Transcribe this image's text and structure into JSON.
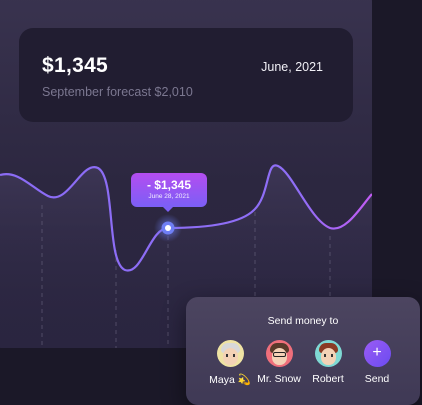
{
  "balance": {
    "amount": "$1,345",
    "date": "June, 2021",
    "forecast": "September forecast $2,010"
  },
  "chart_data": {
    "type": "line",
    "tooltip_amount": "- $1,345",
    "tooltip_date": "June 28, 2021",
    "colors": {
      "line": "#8b6cf5",
      "line_end": "#c25cf5",
      "point": "#6f7ff5"
    }
  },
  "send_money": {
    "title": "Send money to",
    "contacts": [
      {
        "name": "Maya",
        "emoji": "💫",
        "bg": "#efe3a4",
        "hair": "#d8d8d8"
      },
      {
        "name": "Mr. Snow",
        "emoji": "",
        "bg": "#ef6f7b",
        "hair": "#5a3a2a"
      },
      {
        "name": "Robert",
        "emoji": "",
        "bg": "#7fd9d4",
        "hair": "#8a3b24"
      }
    ],
    "send_label": "Send",
    "plus": "+"
  }
}
